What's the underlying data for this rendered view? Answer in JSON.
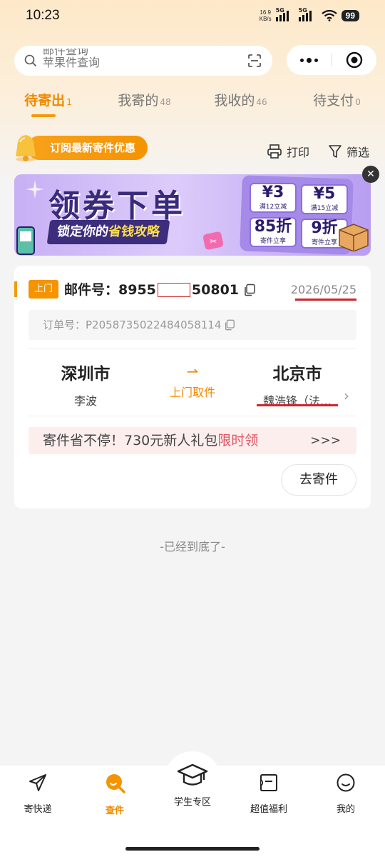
{
  "status_bar": {
    "time": "10:23",
    "net_speed_value": "16.9",
    "net_speed_unit": "KB/s",
    "signal1_label": "5G",
    "signal2_label": "5G",
    "wifi_label": "6",
    "battery": "99"
  },
  "search": {
    "line1": "邮件查询",
    "line2": "苹果件查询"
  },
  "tabs": [
    {
      "label": "待寄出",
      "count": "1",
      "active": true
    },
    {
      "label": "我寄的",
      "count": "48",
      "active": false
    },
    {
      "label": "我收的",
      "count": "46",
      "active": false
    },
    {
      "label": "待支付",
      "count": "0",
      "active": false
    }
  ],
  "toolbar": {
    "subscribe_label": "订阅最新寄件优惠",
    "print_label": "打印",
    "filter_label": "筛选"
  },
  "banner": {
    "title": "领券下单",
    "subtitle_prefix": "锁定你的",
    "subtitle_highlight": "省钱攻略",
    "coupons": [
      {
        "big": "¥3",
        "small": "满12立减"
      },
      {
        "big": "¥5",
        "small": "满15立减"
      },
      {
        "big": "85折",
        "small": "寄件立享"
      },
      {
        "big": "9折",
        "small": "寄件立享"
      }
    ],
    "close_symbol": "✕"
  },
  "order": {
    "badge": "上门",
    "mail_no_label": "邮件号：",
    "mail_no_prefix": "8955",
    "mail_no_suffix": "50801",
    "date": "2026/05/25",
    "order_no_label": "订单号：",
    "order_no": "P2058735022484058114",
    "from_city": "深圳市",
    "from_person": "李波",
    "service": "上门取件",
    "to_city": "北京市",
    "to_person": "魏浩锋（法…",
    "promo_prefix": "寄件省不停！730元新人礼包",
    "promo_highlight": "限时领",
    "promo_more": ">>>",
    "action_label": "去寄件"
  },
  "bottom_note": "-已经到底了-",
  "tabbar": [
    {
      "label": "寄快递",
      "icon": "send-icon",
      "active": false
    },
    {
      "label": "查件",
      "icon": "search-track-icon",
      "active": true
    },
    {
      "label": "学生专区",
      "icon": "graduation-cap-icon",
      "active": false
    },
    {
      "label": "超值福利",
      "icon": "ticket-icon",
      "active": false
    },
    {
      "label": "我的",
      "icon": "smile-icon",
      "active": false
    }
  ],
  "colors": {
    "accent": "#f59a00",
    "redaction": "#d0242b",
    "promo_red": "#e05560"
  }
}
